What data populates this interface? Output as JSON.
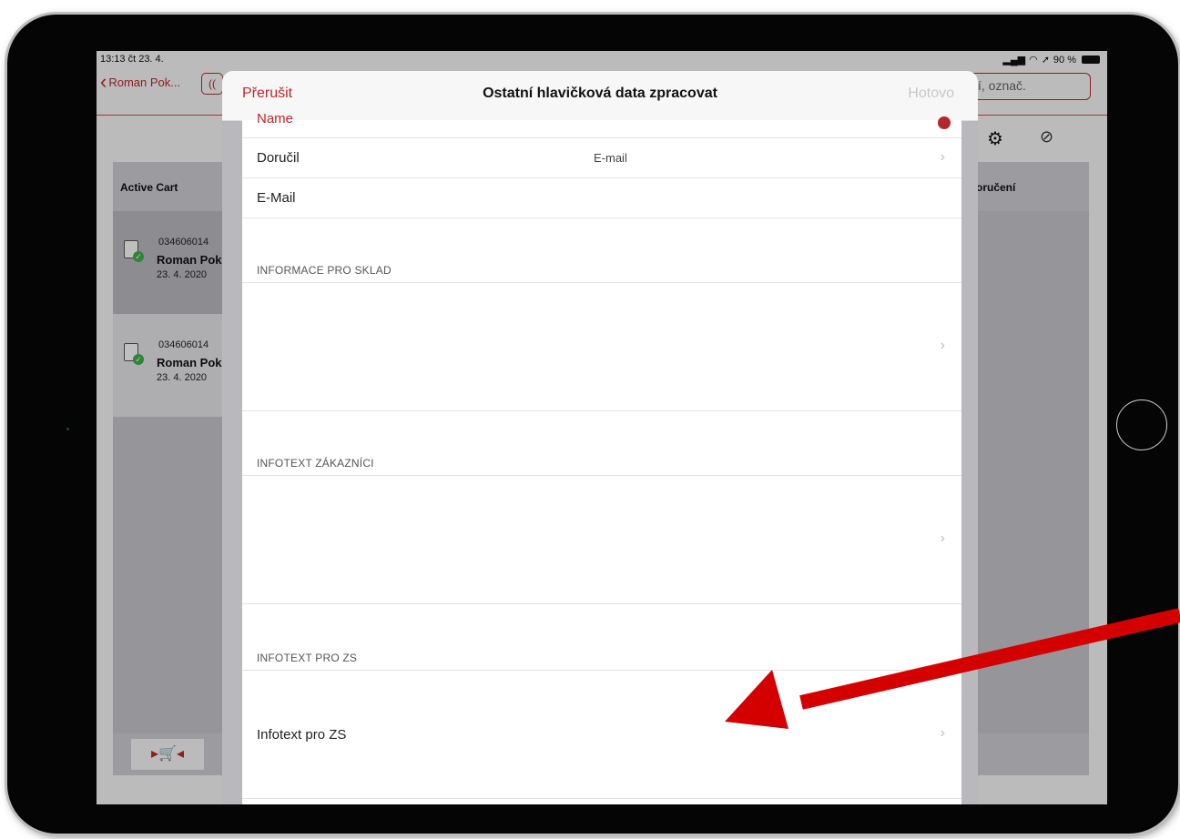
{
  "status_bar": {
    "time": "13:13 čt 23. 4.",
    "battery": "90 %"
  },
  "nav": {
    "back_label": "Roman Pok...",
    "search_text": "ží, označ."
  },
  "table": {
    "col_active": "Active Cart",
    "col_delivery": "oručení",
    "rows": [
      {
        "number": "034606014",
        "name": "Roman Pok",
        "date": "23. 4. 2020"
      },
      {
        "number": "034606014",
        "name": "Roman Pok",
        "date": "23. 4. 2020"
      }
    ]
  },
  "modal": {
    "cancel_label": "Přerušit",
    "title": "Ostatní hlavičková data zpracovat",
    "done_label": "Hotovo",
    "name_label": "Name",
    "delivered_label": "Doručil",
    "delivered_value": "E-mail",
    "email_label": "E-Mail",
    "section_warehouse": "INFORMACE PRO SKLAD",
    "section_customers": "INFOTEXT ZÁKAZNÍCI",
    "section_zs": "INFOTEXT PRO ZS",
    "infotext_zs_label": "Infotext pro ZS"
  },
  "colors": {
    "accent": "#c1272d",
    "annotation_arrow": "#d40000"
  }
}
